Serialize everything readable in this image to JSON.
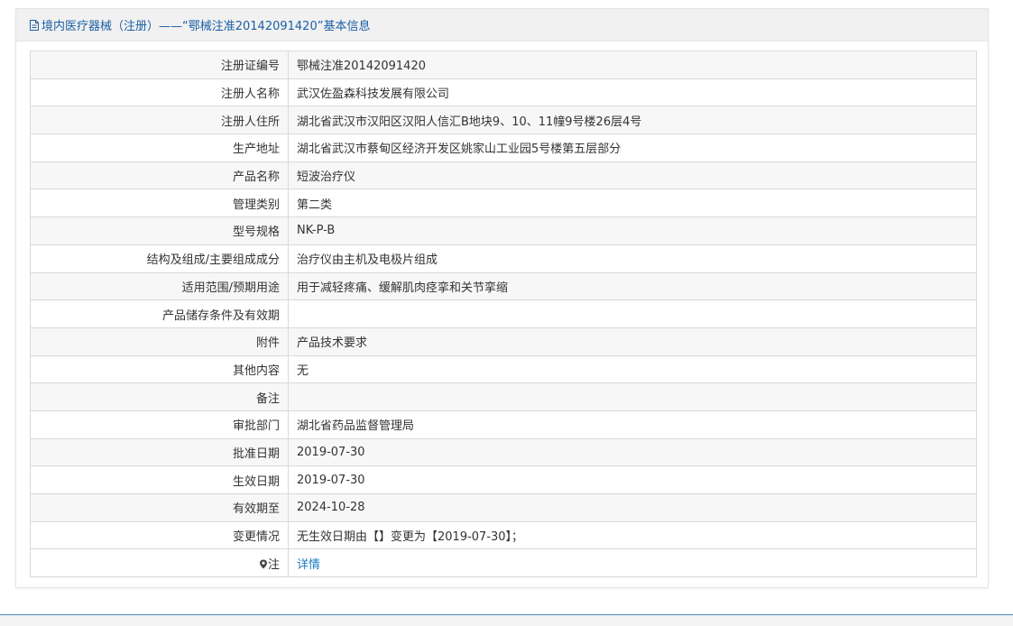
{
  "header": {
    "title": "境内医疗器械（注册）——“鄂械注准20142091420”基本信息"
  },
  "rows": [
    {
      "label": "注册证编号",
      "value": "鄂械注准20142091420"
    },
    {
      "label": "注册人名称",
      "value": "武汉佐盈森科技发展有限公司"
    },
    {
      "label": "注册人住所",
      "value": "湖北省武汉市汉阳区汉阳人信汇B地块9、10、11幢9号楼26层4号"
    },
    {
      "label": "生产地址",
      "value": "湖北省武汉市蔡甸区经济开发区姚家山工业园5号楼第五层部分"
    },
    {
      "label": "产品名称",
      "value": "短波治疗仪"
    },
    {
      "label": "管理类别",
      "value": "第二类"
    },
    {
      "label": "型号规格",
      "value": "NK-P-B"
    },
    {
      "label": "结构及组成/主要组成成分",
      "value": "治疗仪由主机及电极片组成"
    },
    {
      "label": "适用范围/预期用途",
      "value": "用于减轻疼痛、缓解肌肉痉挛和关节挛缩"
    },
    {
      "label": "产品储存条件及有效期",
      "value": ""
    },
    {
      "label": "附件",
      "value": "产品技术要求"
    },
    {
      "label": "其他内容",
      "value": "无"
    },
    {
      "label": "备注",
      "value": ""
    },
    {
      "label": "审批部门",
      "value": "湖北省药品监督管理局"
    },
    {
      "label": "批准日期",
      "value": "2019-07-30"
    },
    {
      "label": "生效日期",
      "value": "2019-07-30"
    },
    {
      "label": "有效期至",
      "value": "2024-10-28"
    },
    {
      "label": "变更情况",
      "value": "无生效日期由【】变更为【2019-07-30】；"
    }
  ],
  "note": {
    "label": "注",
    "link_text": "详情"
  },
  "colors": {
    "accent": "#1a5fa5",
    "link": "#1a7bbf",
    "border": "#d9d9d9",
    "stripe": "#f7f7f7"
  }
}
